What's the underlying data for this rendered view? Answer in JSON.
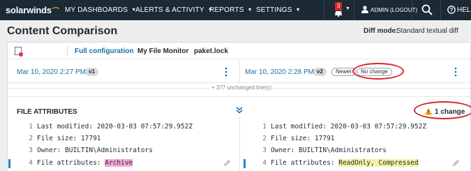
{
  "nav": {
    "logo": "solarwinds",
    "items": [
      "MY DASHBOARDS",
      "ALERTS & ACTIVITY",
      "REPORTS",
      "SETTINGS"
    ],
    "alert_count": "3",
    "admin": "ADMIN (LOGOUT)",
    "help": "HELP"
  },
  "page": {
    "title": "Content Comparison",
    "diff_mode_label": "Diff mode:",
    "diff_mode_value": "Standard textual diff"
  },
  "tabs": [
    "Full configuration",
    "My File Monitor",
    "paket.lock"
  ],
  "left_version": {
    "date": "Mar 10, 2020 2:27 PM",
    "tag": "v1"
  },
  "right_version": {
    "date": "Mar 10, 2020 2:28 PM",
    "tag": "v2",
    "newer": "Newer",
    "status": "No change"
  },
  "unchanged_lines": "+ 377 unchanged line(s)",
  "section": {
    "title": "FILE ATTRIBUTES",
    "changes": "1 change"
  },
  "left_lines": [
    {
      "num": "1",
      "text": "Last modified: 2020-03-03 07:57:29.952Z"
    },
    {
      "num": "2",
      "text": "File size: 17791"
    },
    {
      "num": "3",
      "text": "Owner: BUILTIN\\Administrators"
    },
    {
      "num": "4",
      "prefix": "File attributes: ",
      "highlight": "Archive"
    }
  ],
  "right_lines": [
    {
      "num": "1",
      "text": "Last modified: 2020-03-03 07:57:29.952Z"
    },
    {
      "num": "2",
      "text": "File size: 17791"
    },
    {
      "num": "3",
      "text": "Owner: BUILTIN\\Administrators"
    },
    {
      "num": "4",
      "prefix": "File attributes: ",
      "highlight": "ReadOnly, Compressed"
    }
  ],
  "colors": {
    "nav_bg": "#1b2a35",
    "accent": "#1a6fa7",
    "alert": "#d7262d",
    "removed": "#f6a9d6",
    "added": "#f3f0a4"
  }
}
